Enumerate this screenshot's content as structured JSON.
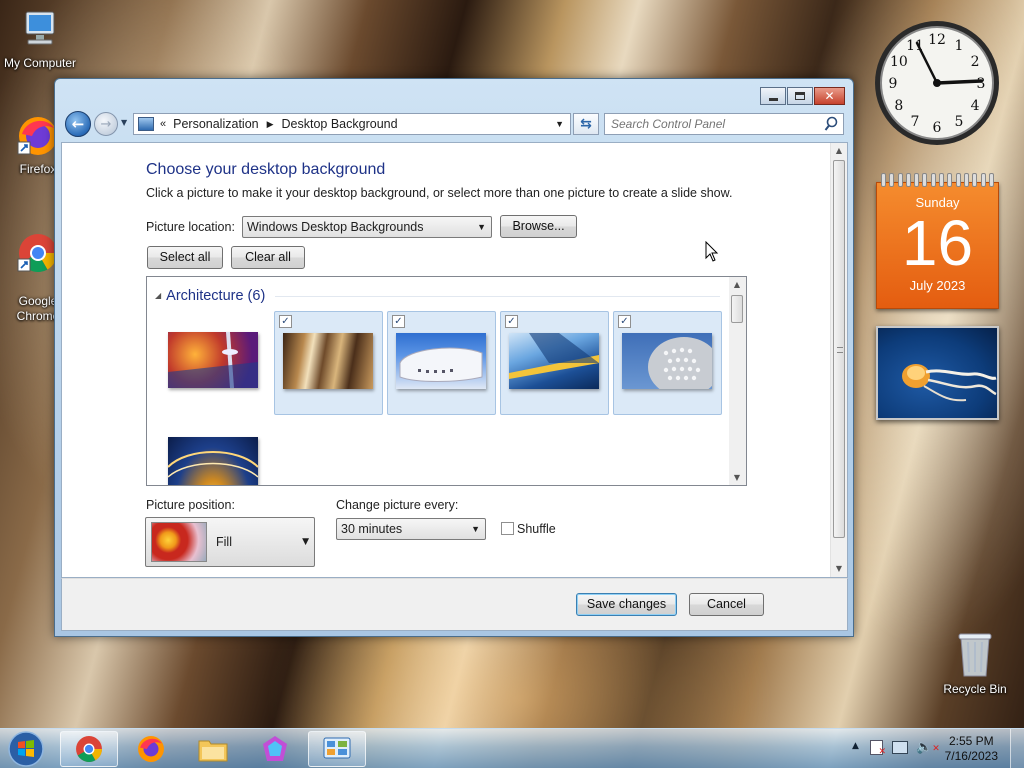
{
  "desktop": {
    "icons": [
      {
        "label": "My Computer",
        "icon": "computer-icon"
      },
      {
        "label": "Firefox",
        "icon": "firefox-icon"
      },
      {
        "label": "Google\nChrome",
        "icon": "chrome-icon"
      },
      {
        "label": "Recycle Bin",
        "icon": "recycle-bin-icon"
      }
    ]
  },
  "gadgets": {
    "clock": {
      "time": "2:55",
      "numerals": [
        "12",
        "1",
        "2",
        "3",
        "4",
        "5",
        "6",
        "7",
        "8",
        "9",
        "10",
        "11"
      ]
    },
    "calendar": {
      "weekday": "Sunday",
      "day": "16",
      "month_year": "July 2023",
      "color": "#e8661a"
    }
  },
  "window": {
    "breadcrumb_prefix": "«",
    "breadcrumb": [
      "Personalization",
      "Desktop Background"
    ],
    "search_placeholder": "Search Control Panel",
    "caption": {
      "minimize": "minimize",
      "maximize": "maximize",
      "close": "close"
    },
    "title": "Choose your desktop background",
    "subtitle": "Click a picture to make it your desktop background, or select more than one picture to create a slide show.",
    "picture_location_label": "Picture location:",
    "picture_location_value": "Windows Desktop Backgrounds",
    "browse_label": "Browse...",
    "select_all_label": "Select all",
    "clear_all_label": "Clear all",
    "group": {
      "name": "Architecture (6)",
      "tiles": [
        {
          "name": "architecture-1",
          "checked": false
        },
        {
          "name": "architecture-2",
          "checked": true
        },
        {
          "name": "architecture-3",
          "checked": true
        },
        {
          "name": "architecture-4",
          "checked": true
        },
        {
          "name": "architecture-5",
          "checked": true
        },
        {
          "name": "architecture-6",
          "checked": false
        }
      ]
    },
    "picture_position_label": "Picture position:",
    "picture_position_value": "Fill",
    "change_every_label": "Change picture every:",
    "change_every_value": "30 minutes",
    "shuffle_label": "Shuffle",
    "shuffle_checked": false,
    "save_label": "Save changes",
    "cancel_label": "Cancel"
  },
  "taskbar": {
    "apps": [
      "start-orb",
      "chrome",
      "firefox",
      "file-explorer",
      "pinned-app",
      "control-panel"
    ],
    "clock_time": "2:55 PM",
    "clock_date": "7/16/2023",
    "accent": "#6a9bc9"
  }
}
